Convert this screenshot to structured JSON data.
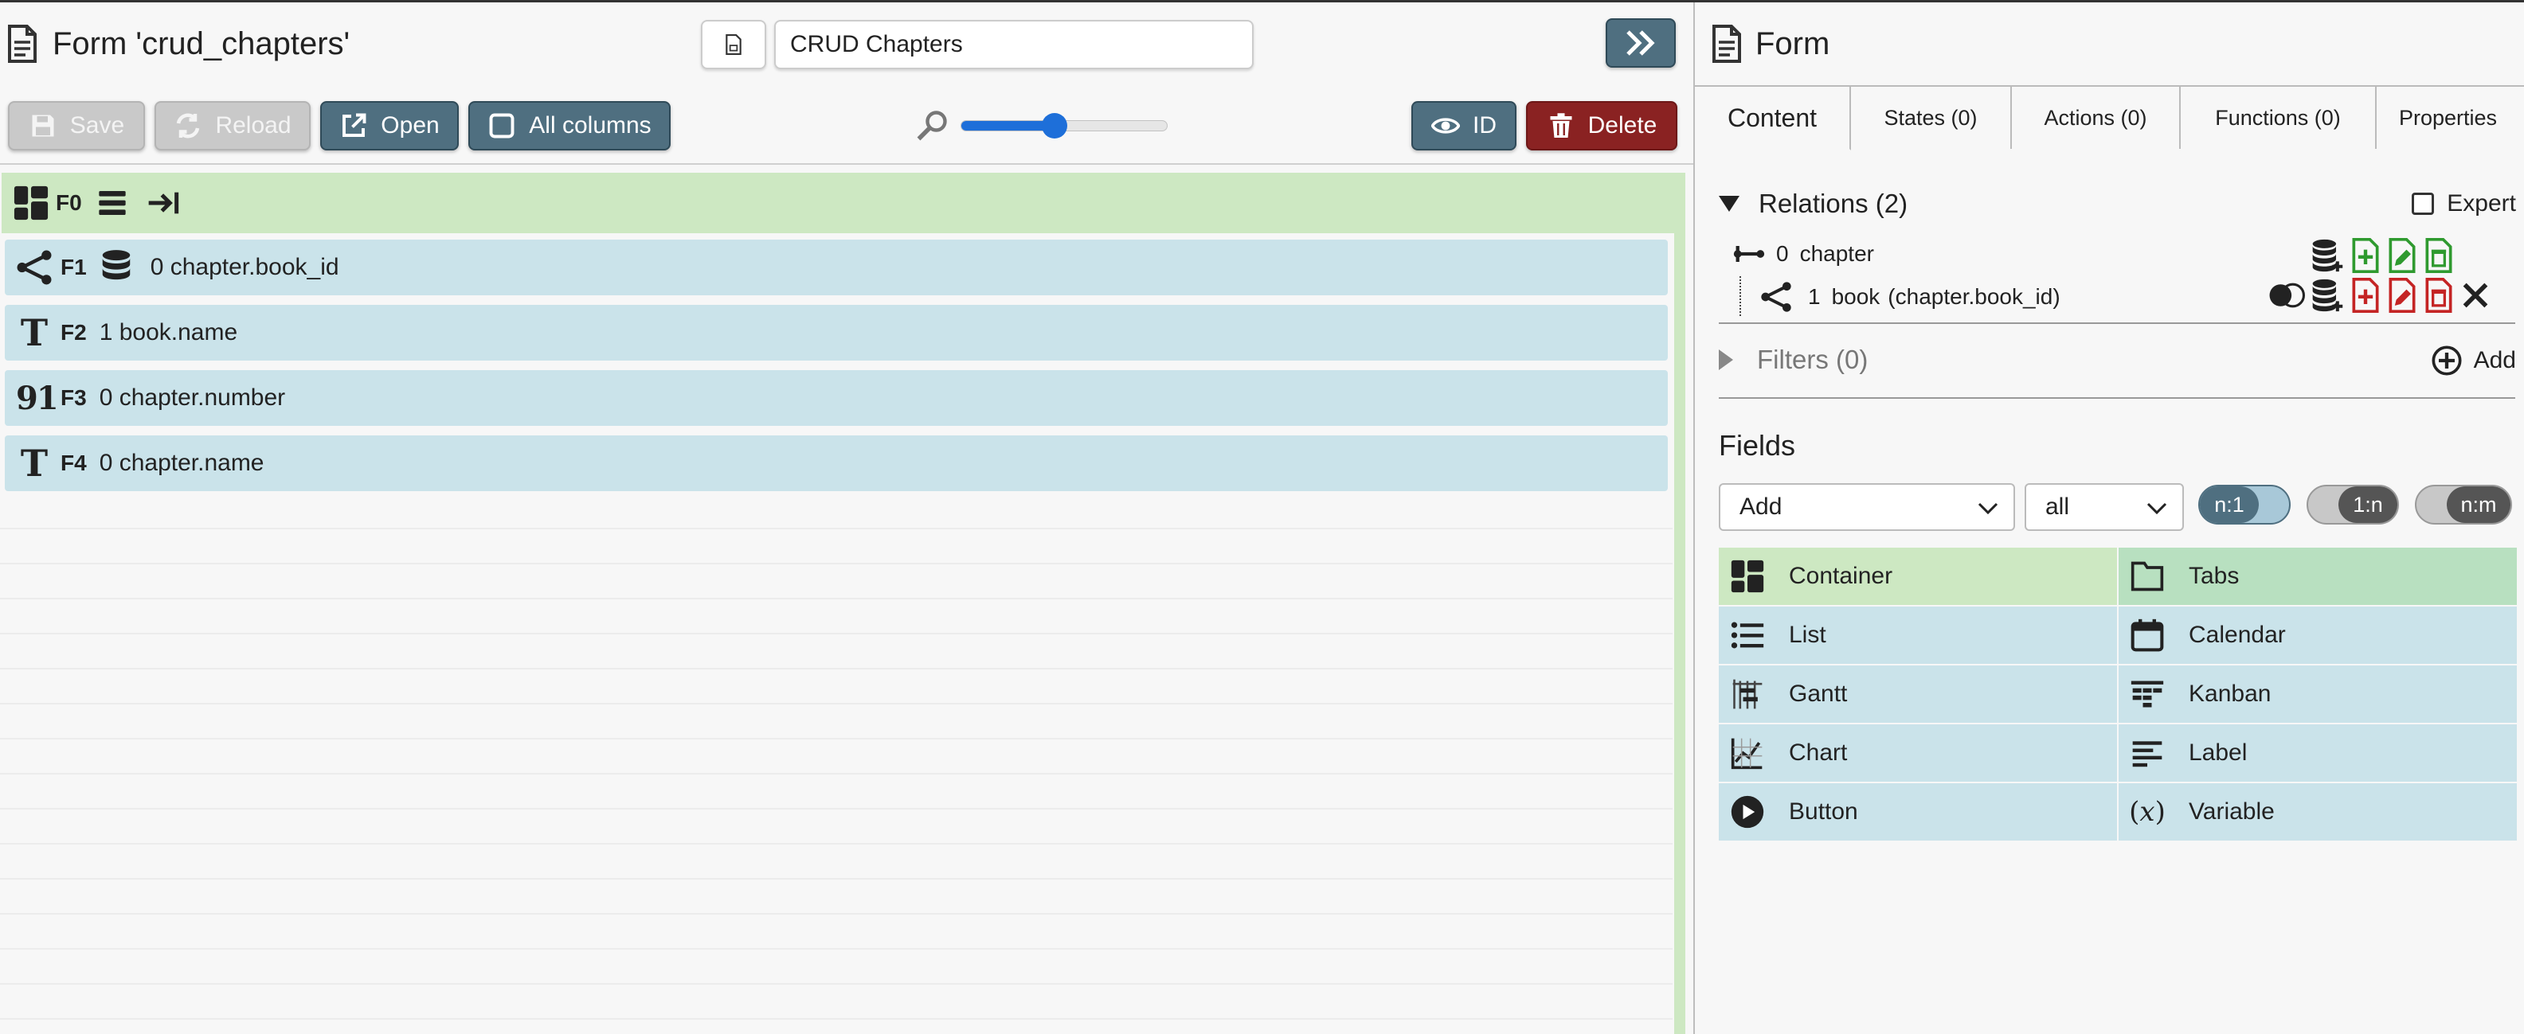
{
  "left": {
    "form_title": "Form 'crud_chapters'",
    "title_input_value": "CRUD Chapters",
    "toolbar": {
      "save_label": "Save",
      "reload_label": "Reload",
      "open_label": "Open",
      "all_columns_label": "All columns",
      "id_label": "ID",
      "delete_label": "Delete"
    },
    "zoom_level": 0.45,
    "root_field": {
      "id": "F0"
    },
    "fields": [
      {
        "id": "F1",
        "text": "0 chapter.book_id",
        "icon": "relation-icon"
      },
      {
        "id": "F2",
        "text": "1 book.name",
        "icon": "text-type-icon"
      },
      {
        "id": "F3",
        "text": "0 chapter.number",
        "icon": "number-type-icon"
      },
      {
        "id": "F4",
        "text": "0 chapter.name",
        "icon": "text-type-icon"
      }
    ],
    "number_icon_glyph": "91",
    "text_icon_glyph": "T"
  },
  "right": {
    "title": "Form",
    "tabs": [
      {
        "label": "Content",
        "active": true
      },
      {
        "label": "States (0)",
        "active": false
      },
      {
        "label": "Actions (0)",
        "active": false
      },
      {
        "label": "Functions (0)",
        "active": false
      },
      {
        "label": "Properties",
        "active": false
      }
    ],
    "relations": {
      "heading": "Relations (2)",
      "expert_label": "Expert",
      "items": [
        {
          "index": "0",
          "label": "chapter"
        },
        {
          "index": "1",
          "label": "book",
          "detail": "(chapter.book_id)"
        }
      ]
    },
    "filters": {
      "heading": "Filters (0)",
      "add_label": "Add"
    },
    "fields_section": {
      "heading": "Fields",
      "add_select": "Add",
      "scope_select": "all",
      "toggles": [
        "n:1",
        "1:n",
        "n:m"
      ],
      "types": [
        {
          "label": "Container",
          "icon": "container-icon",
          "color": "#cde8c2"
        },
        {
          "label": "Tabs",
          "icon": "tabs-icon",
          "color": "#b8e0c0"
        },
        {
          "label": "List",
          "icon": "list-icon",
          "color": "#cae3ea"
        },
        {
          "label": "Calendar",
          "icon": "calendar-icon",
          "color": "#cae3ea"
        },
        {
          "label": "Gantt",
          "icon": "gantt-icon",
          "color": "#cae3ea"
        },
        {
          "label": "Kanban",
          "icon": "kanban-icon",
          "color": "#cae3ea"
        },
        {
          "label": "Chart",
          "icon": "chart-icon",
          "color": "#cae3ea"
        },
        {
          "label": "Label",
          "icon": "label-icon",
          "color": "#cae3ea"
        },
        {
          "label": "Button",
          "icon": "button-icon",
          "color": "#cae3ea"
        },
        {
          "label": "Variable",
          "icon": "variable-icon",
          "color": "#cae3ea"
        }
      ],
      "variable_glyph": "(𝑥)"
    }
  },
  "colors": {
    "accent": "#4f6f80",
    "danger": "#8a2222",
    "container_green": "#cde8c2",
    "field_blue": "#cae3ea",
    "action_green": "#2f9a2f",
    "action_red": "#c42424"
  }
}
